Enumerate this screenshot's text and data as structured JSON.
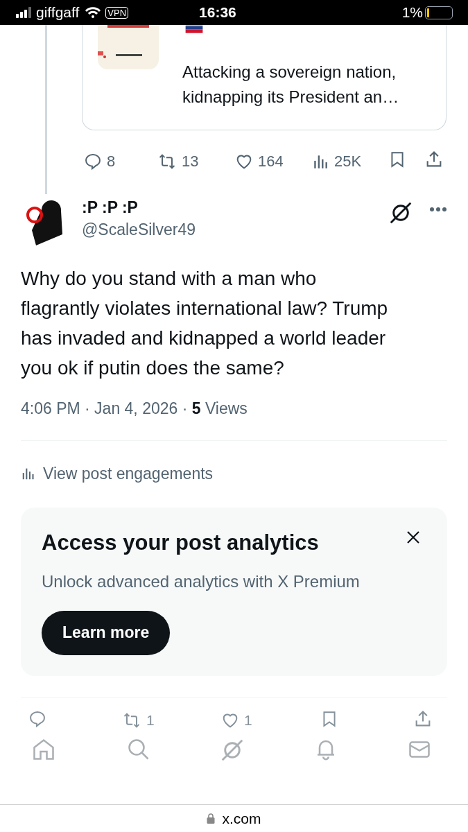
{
  "status_bar": {
    "carrier": "giffgaff",
    "vpn": "VPN",
    "time": "16:36",
    "battery_text": "1%"
  },
  "quoted_post": {
    "text_lines": [
      "Attacking a sovereign nation,",
      "kidnapping its President an…"
    ],
    "actions": [
      {
        "kind": "reply",
        "count": "8"
      },
      {
        "kind": "repost",
        "count": "13"
      },
      {
        "kind": "like",
        "count": "164"
      },
      {
        "kind": "views",
        "count": "25K"
      },
      {
        "kind": "bookmark"
      },
      {
        "kind": "share"
      }
    ]
  },
  "post": {
    "display_name": ":P :P :P",
    "handle": "@ScaleSilver49",
    "body_lines": [
      "Why do you stand with a man who",
      "flagrantly violates international law? Trump",
      "has invaded and kidnapped a world leader",
      "you ok if putin does the same?"
    ],
    "timestamp": "4:06 PM · Jan 4, 2026 · ",
    "views_count": "5",
    "views_label": " Views",
    "engagements_link": "View post engagements"
  },
  "promo": {
    "title": "Access your post analytics",
    "subtitle": "Unlock advanced analytics with X Premium",
    "button": "Learn more"
  },
  "bottom_actions": [
    {
      "kind": "reply"
    },
    {
      "kind": "repost",
      "count": "1"
    },
    {
      "kind": "like",
      "count": "1"
    },
    {
      "kind": "bookmark"
    },
    {
      "kind": "share"
    }
  ],
  "nav": [
    {
      "kind": "home",
      "selected": false
    },
    {
      "kind": "search",
      "selected": false
    },
    {
      "kind": "grok",
      "selected": false
    },
    {
      "kind": "notifications",
      "selected": false
    },
    {
      "kind": "messages",
      "selected": false
    }
  ],
  "url_bar": {
    "url": "x.com"
  }
}
